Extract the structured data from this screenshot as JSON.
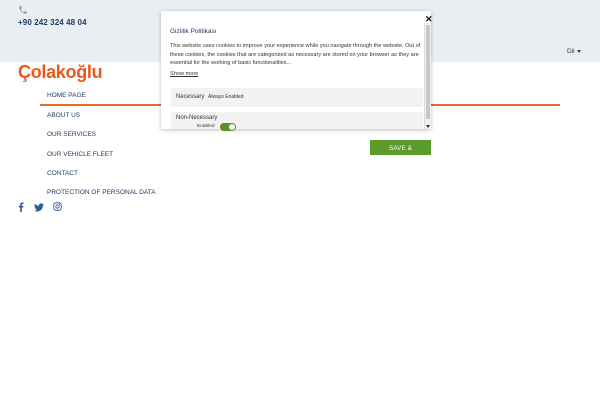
{
  "header": {
    "phone": "+90 242 324 48 04",
    "language": "Dil"
  },
  "brand": {
    "logo_text": "Çolakoğlu",
    "accent": "#e85a1b"
  },
  "nav": {
    "items": [
      "HOME PAGE",
      "ABOUT US",
      "OUR SERVICES",
      "OUR VEHICLE FLEET",
      "CONTACT",
      "PROTECTION OF PERSONAL DATA"
    ]
  },
  "social": {
    "icons": [
      "facebook-icon",
      "twitter-icon",
      "instagram-icon"
    ]
  },
  "modal": {
    "title": "Gizlilik Politikası",
    "body": "This website uses cookies to improve your experience while you navigate through the website. Out of these cookies, the cookies that are categorized as necessary are stored on your browser as they are essential for the working of basic functionalities...",
    "show_more": "Show more",
    "close": "✕",
    "necessary": {
      "label": "Necessary",
      "status": "Always Enabled"
    },
    "non_necessary": {
      "label": "Non-Necessary",
      "status": "Enabled"
    }
  },
  "cta": {
    "save_accept": "SAVE & ACCEPT",
    "color": "#5c9c2d"
  }
}
